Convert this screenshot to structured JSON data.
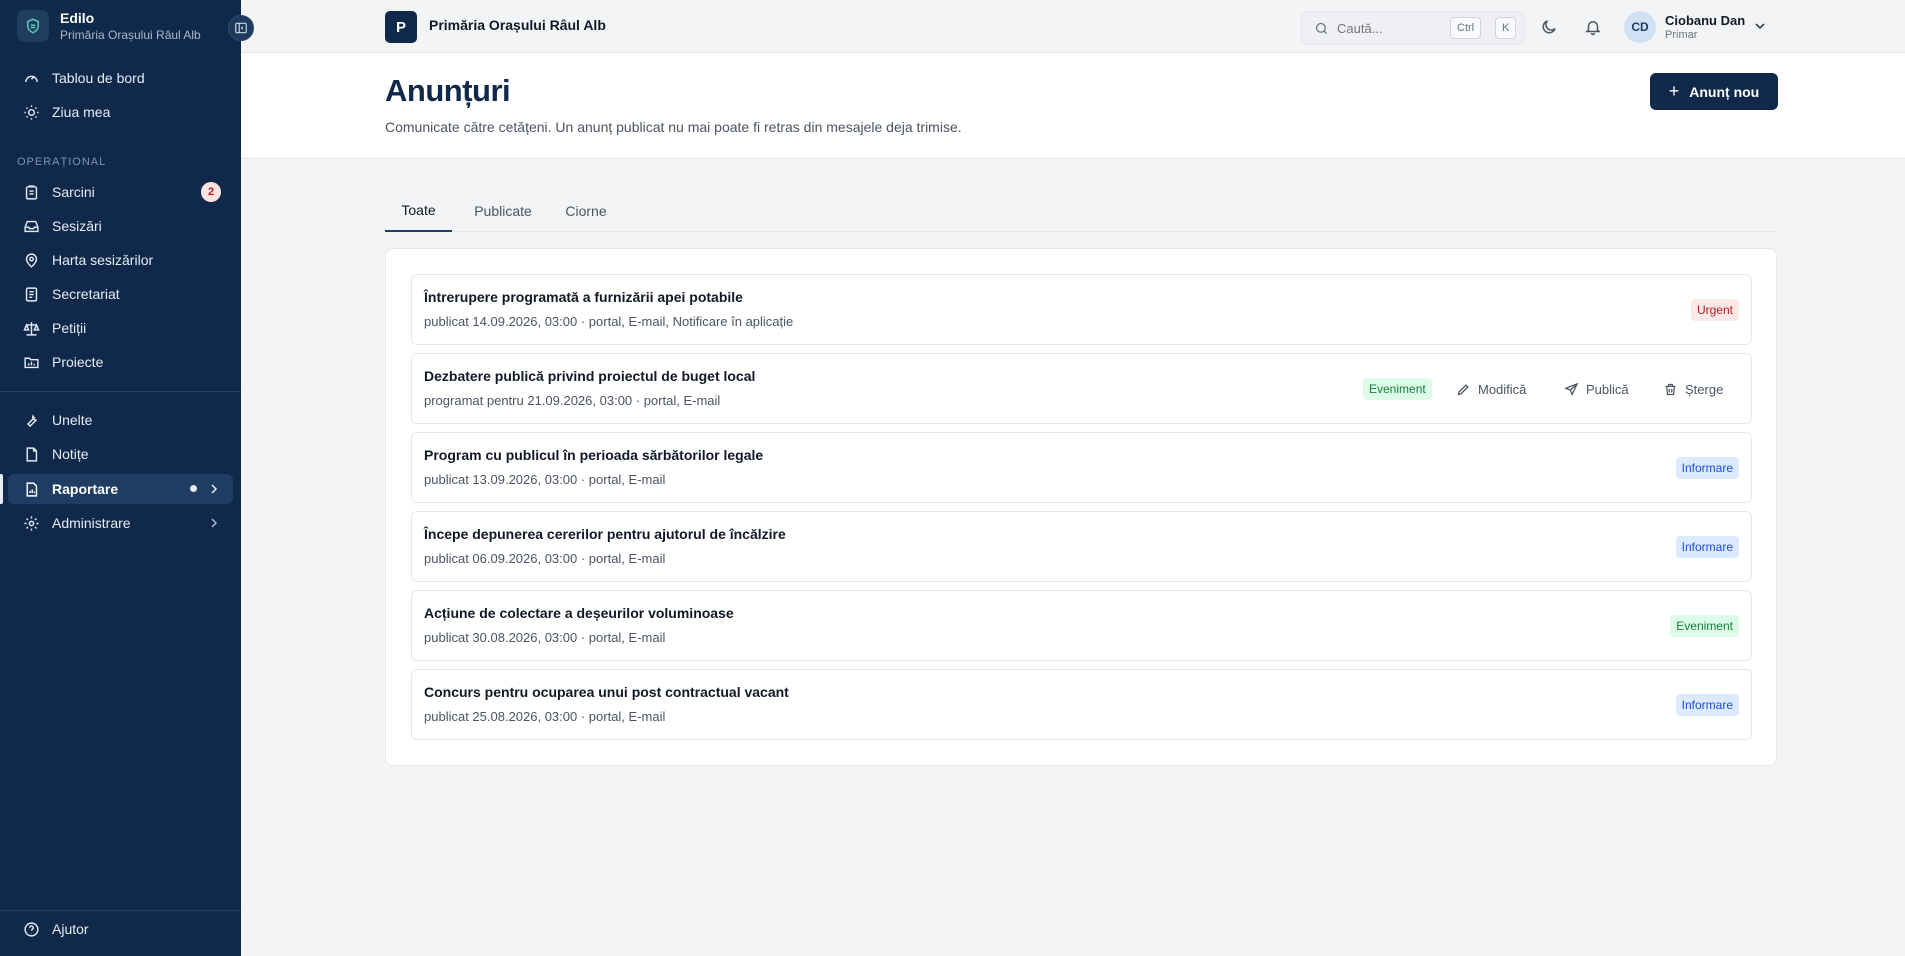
{
  "sidebar": {
    "brand_name": "Edilo",
    "brand_sub": "Primăria Orașului Râul Alb",
    "section_label": "OPERAȚIONAL",
    "items": [
      {
        "label": "Tablou de bord",
        "icon": "gauge-icon"
      },
      {
        "label": "Ziua mea",
        "icon": "sun-icon"
      },
      {
        "label": "Sarcini",
        "icon": "clipboard-icon",
        "badge": "2"
      },
      {
        "label": "Sesizări",
        "icon": "inbox-icon"
      },
      {
        "label": "Harta sesizărilor",
        "icon": "map-pin-icon"
      },
      {
        "label": "Secretariat",
        "icon": "document-icon"
      },
      {
        "label": "Petiții",
        "icon": "scale-icon"
      },
      {
        "label": "Proiecte",
        "icon": "folder-icon"
      },
      {
        "label": "Unelte",
        "icon": "wrench-icon"
      },
      {
        "label": "Notițe",
        "icon": "note-icon"
      },
      {
        "label": "Raportare",
        "icon": "report-icon",
        "active": true
      },
      {
        "label": "Administrare",
        "icon": "gear-icon"
      }
    ],
    "help_label": "Ajutor"
  },
  "topbar": {
    "org_initial": "P",
    "org_name": "Primăria Orașului Râul Alb",
    "search_placeholder": "Caută...",
    "kbd_ctrl": "Ctrl",
    "kbd_k": "K",
    "user_initials": "CD",
    "user_name": "Ciobanu Dan",
    "user_role": "Primar"
  },
  "header": {
    "title": "Anunțuri",
    "description": "Comunicate către cetățeni. Un anunț publicat nu mai poate fi retras din mesajele deja trimise.",
    "new_button": "Anunț nou"
  },
  "tabs": [
    {
      "label": "Toate",
      "active": true
    },
    {
      "label": "Publicate"
    },
    {
      "label": "Ciorne"
    }
  ],
  "announcements": [
    {
      "title": "Întrerupere programată a furnizării apei potabile",
      "meta": "publicat 14.09.2026, 03:00 · portal, E-mail, Notificare în aplicație",
      "tag": "Urgent",
      "tag_type": "urgent"
    },
    {
      "title": "Dezbatere publică privind proiectul de buget local",
      "meta": "programat pentru 21.09.2026, 03:00 · portal, E-mail",
      "tag": "Eveniment",
      "tag_type": "event"
    },
    {
      "title": "Program cu publicul în perioada sărbătorilor legale",
      "meta": "publicat 13.09.2026, 03:00 · portal, E-mail",
      "tag": "Informare",
      "tag_type": "info"
    },
    {
      "title": "Începe depunerea cererilor pentru ajutorul de încălzire",
      "meta": "publicat 06.09.2026, 03:00 · portal, E-mail",
      "tag": "Informare",
      "tag_type": "info"
    },
    {
      "title": "Acțiune de colectare a deșeurilor voluminoase",
      "meta": "publicat 30.08.2026, 03:00 · portal, E-mail",
      "tag": "Eveniment",
      "tag_type": "event"
    },
    {
      "title": "Concurs pentru ocuparea unui post contractual vacant",
      "meta": "publicat 25.08.2026, 03:00 · portal, E-mail",
      "tag": "Informare",
      "tag_type": "info"
    }
  ],
  "row_actions": {
    "edit": "Modifică",
    "publish": "Publică",
    "delete": "Șterge"
  },
  "colors": {
    "sidebar_bg": "#10294a",
    "accent": "#10294a",
    "urgent": "#b91c1c",
    "event": "#15803d",
    "info": "#1d4ed8"
  }
}
